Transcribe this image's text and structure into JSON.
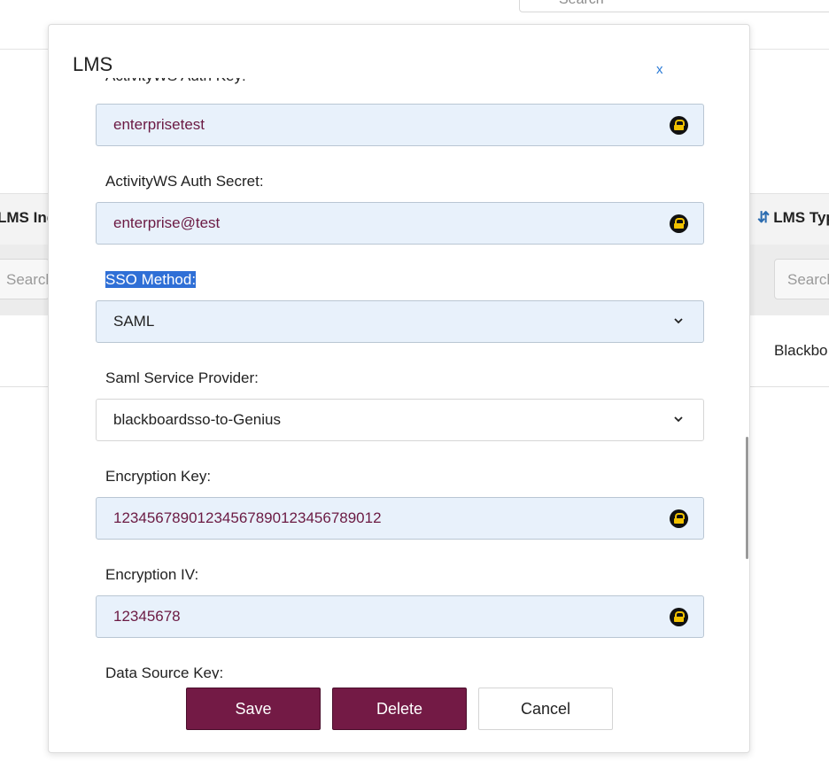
{
  "background": {
    "search_placeholder": "Search",
    "col_left_header": "LMS Ind",
    "col_right_header": "LMS Typ",
    "filter_left_placeholder": "Search",
    "filter_right_placeholder": "Search",
    "row_right_value": "Blackbo"
  },
  "modal": {
    "title": "LMS",
    "close_label": "x",
    "cut_off_label": "ActivityWS Auth Key:",
    "fields": [
      {
        "label": "",
        "value": "enterprisetest",
        "icon": "lock-icon"
      },
      {
        "label": "ActivityWS Auth Secret:",
        "value": "enterprise@test",
        "icon": "lock-icon"
      },
      {
        "label": "SSO Method:",
        "value": "SAML",
        "icon": "chevron-down-icon",
        "label_selected": true
      },
      {
        "label": "Saml Service Provider:",
        "value": "blackboardsso-to-Genius",
        "icon": "chevron-down-icon"
      },
      {
        "label": "Encryption Key:",
        "value": "12345678901234567890123456789012",
        "icon": "lock-icon"
      },
      {
        "label": "Encryption IV:",
        "value": "12345678",
        "icon": "lock-icon"
      },
      {
        "label": "Data Source Key:"
      }
    ],
    "buttons": {
      "save": "Save",
      "delete": "Delete",
      "cancel": "Cancel"
    }
  },
  "colors": {
    "primary": "#731a45",
    "field_bg": "#e8f1fb",
    "value_text": "#6b1a43",
    "link": "#2b7bd6",
    "selection": "#2f6fd6",
    "lock_badge": "#f2c200"
  }
}
